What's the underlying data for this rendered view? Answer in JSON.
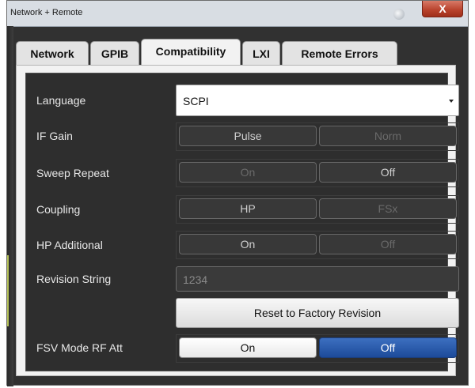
{
  "window": {
    "title": "Network + Remote",
    "close_glyph": "X"
  },
  "tabs": [
    {
      "label": "Network"
    },
    {
      "label": "GPIB"
    },
    {
      "label": "Compatibility",
      "active": true
    },
    {
      "label": "LXI"
    },
    {
      "label": "Remote Errors"
    }
  ],
  "settings": {
    "language": {
      "label": "Language",
      "value": "SCPI"
    },
    "if_gain": {
      "label": "IF Gain",
      "options": [
        "Pulse",
        "Norm"
      ],
      "selected": "Pulse"
    },
    "sweep_repeat": {
      "label": "Sweep Repeat",
      "options": [
        "On",
        "Off"
      ],
      "selected": "Off"
    },
    "coupling": {
      "label": "Coupling",
      "options": [
        "HP",
        "FSx"
      ],
      "selected": "HP"
    },
    "hp_additional": {
      "label": "HP Additional",
      "options": [
        "On",
        "Off"
      ],
      "selected": "On"
    },
    "revision_string": {
      "label": "Revision String",
      "value": "1234"
    },
    "reset_label": "Reset to Factory Revision",
    "fsv_mode_rf_att": {
      "label": "FSV Mode RF Att",
      "options": [
        "On",
        "Off"
      ],
      "selected": "Off"
    }
  },
  "colors": {
    "background": "#313131",
    "panel": "#f2f2f2",
    "accent_selected": "#1d4b9a",
    "close_button": "#b8412b"
  }
}
